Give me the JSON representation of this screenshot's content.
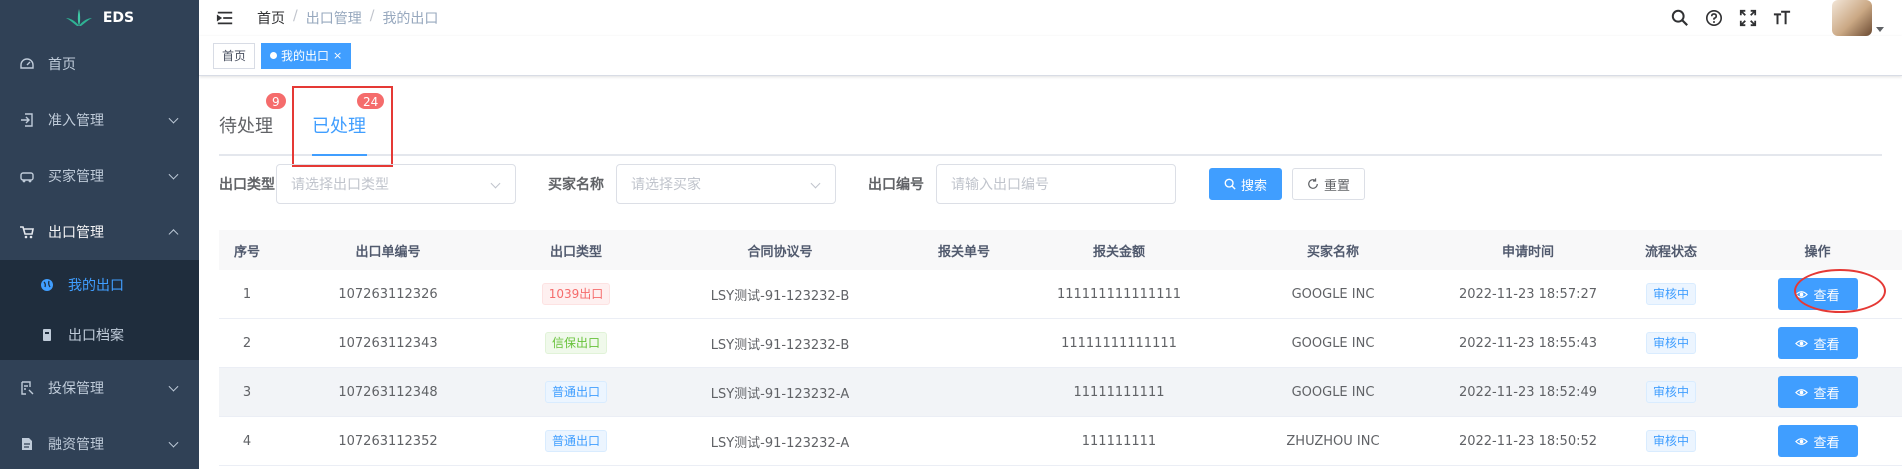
{
  "app": {
    "logo_text": "EDS"
  },
  "sidebar": {
    "items": [
      {
        "label": "首页",
        "icon": "dashboard-icon"
      },
      {
        "label": "准入管理",
        "icon": "enter-icon",
        "arrow": true
      },
      {
        "label": "买家管理",
        "icon": "buyer-icon",
        "arrow": true
      },
      {
        "label": "出口管理",
        "icon": "cart-icon",
        "arrow": true,
        "open": true
      },
      {
        "label": "投保管理",
        "icon": "insure-icon",
        "arrow": true
      },
      {
        "label": "融资管理",
        "icon": "finance-icon",
        "arrow": true
      }
    ],
    "submenu": [
      {
        "label": "我的出口",
        "icon": "globe-icon",
        "active": true
      },
      {
        "label": "出口档案",
        "icon": "archive-icon"
      }
    ]
  },
  "breadcrumb": {
    "home": "首页",
    "sep1": "/",
    "mid": "出口管理",
    "sep2": "/",
    "current": "我的出口"
  },
  "tags_view": {
    "home": "首页",
    "active": "我的出口",
    "close": "×"
  },
  "tabs": [
    {
      "label": "待处理",
      "badge": "9"
    },
    {
      "label": "已处理",
      "badge": "24"
    }
  ],
  "filters": {
    "type_label": "出口类型",
    "type_placeholder": "请选择出口类型",
    "buyer_label": "买家名称",
    "buyer_placeholder": "请选择买家",
    "no_label": "出口编号",
    "no_placeholder": "请输入出口编号",
    "search": "搜索",
    "reset": "重置"
  },
  "table": {
    "headers": [
      "序号",
      "出口单编号",
      "出口类型",
      "合同协议号",
      "报关单号",
      "报关金额",
      "买家名称",
      "申请时间",
      "流程状态",
      "操作"
    ],
    "rows": [
      {
        "idx": "1",
        "no": "107263112326",
        "type": "1039出口",
        "type_style": "danger",
        "contract": "LSY测试-91-123232-B",
        "customs": "",
        "amount": "111111111111111",
        "buyer": "GOOGLE INC",
        "time": "2022-11-23 18:57:27",
        "status": "审核中",
        "action": "查看"
      },
      {
        "idx": "2",
        "no": "107263112343",
        "type": "信保出口",
        "type_style": "success",
        "contract": "LSY测试-91-123232-B",
        "customs": "",
        "amount": "11111111111111",
        "buyer": "GOOGLE INC",
        "time": "2022-11-23 18:55:43",
        "status": "审核中",
        "action": "查看"
      },
      {
        "idx": "3",
        "no": "107263112348",
        "type": "普通出口",
        "type_style": "info",
        "contract": "LSY测试-91-123232-A",
        "customs": "",
        "amount": "11111111111",
        "buyer": "GOOGLE INC",
        "time": "2022-11-23 18:52:49",
        "status": "审核中",
        "action": "查看"
      },
      {
        "idx": "4",
        "no": "107263112352",
        "type": "普通出口",
        "type_style": "info",
        "contract": "LSY测试-91-123232-A",
        "customs": "",
        "amount": "111111111",
        "buyer": "ZHUZHOU INC",
        "time": "2022-11-23 18:50:52",
        "status": "审核中",
        "action": "查看"
      }
    ]
  },
  "colors": {
    "sidebar_bg": "#304156",
    "primary": "#409eff",
    "highlight": "#e53935",
    "badge": "#f56c6c"
  }
}
